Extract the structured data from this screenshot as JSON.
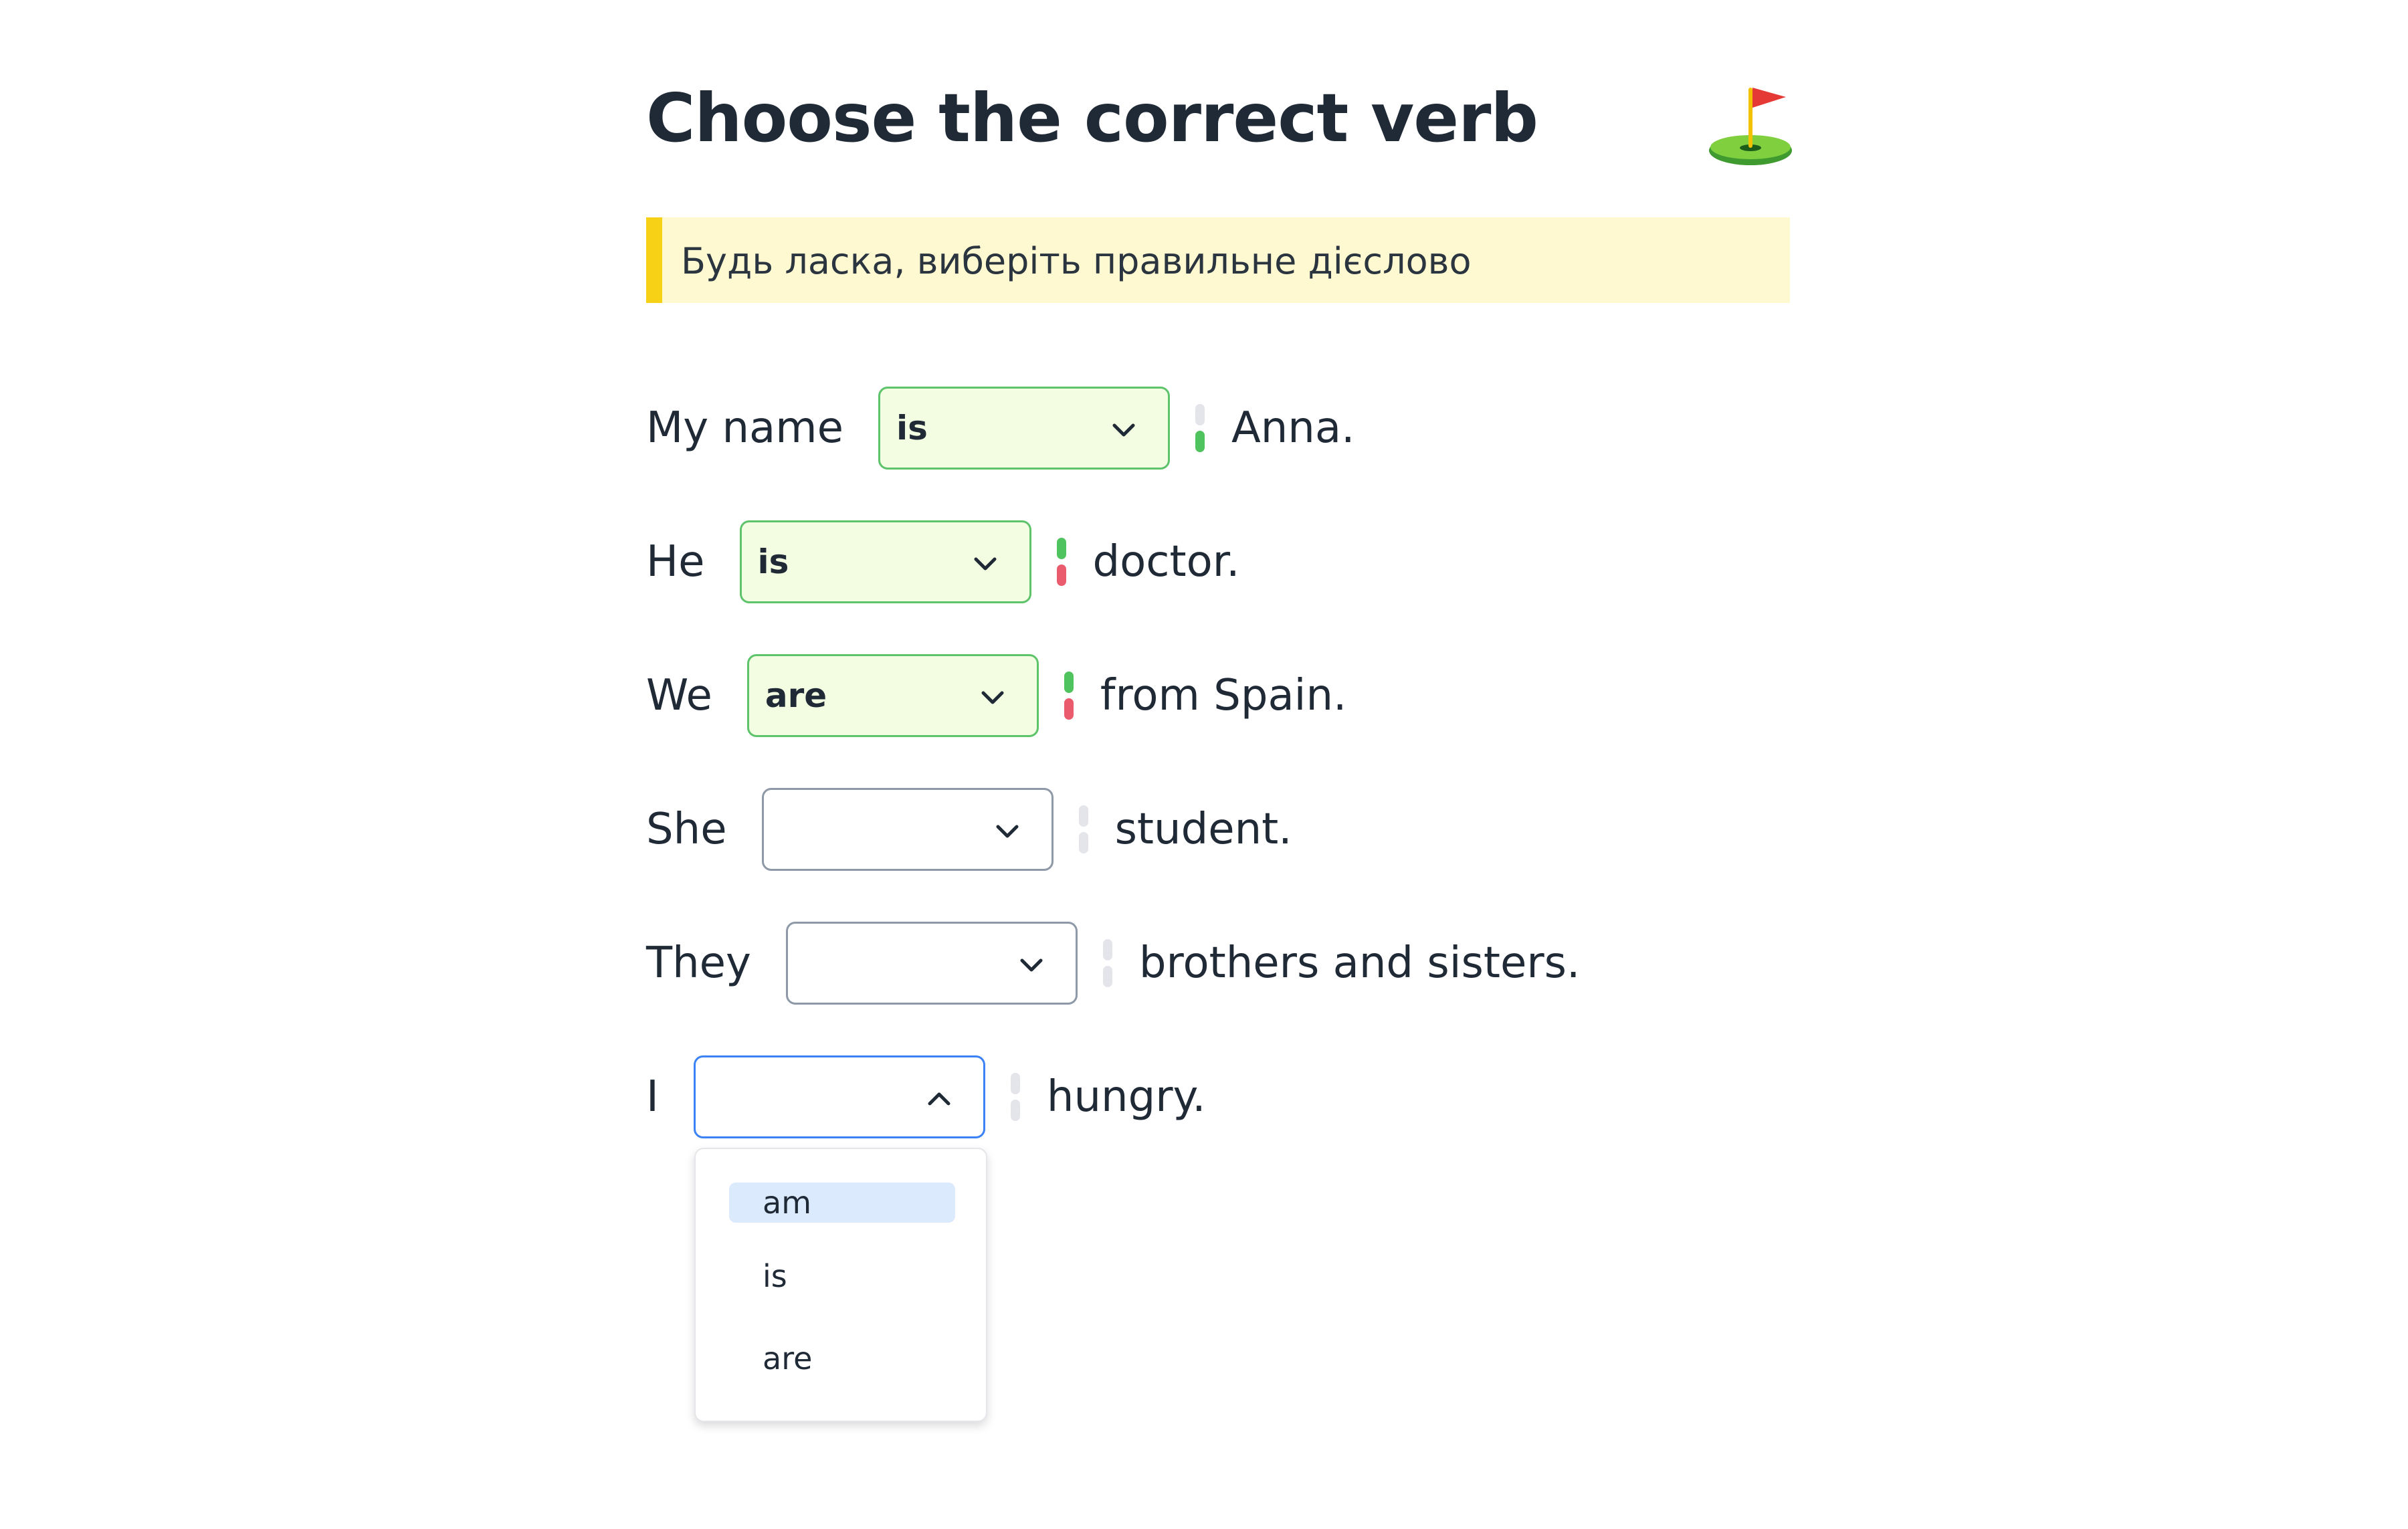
{
  "title": "Choose the correct verb",
  "flag_icon": "golf-flag-icon",
  "instruction": "Будь ласка, виберіть правильне дієслово",
  "colors": {
    "correct_border": "#5ec46b",
    "correct_bg": "#f3fde2",
    "instruction_bg": "#fef9d1",
    "instruction_bar": "#f7d116",
    "open_border": "#3b82f6",
    "indicator_green": "#4ec35e",
    "indicator_red": "#ea5b6e"
  },
  "sentences": [
    {
      "prefix": "My name",
      "selected": "is",
      "suffix": "Anna.",
      "state": "correct",
      "indicator": [
        "gray",
        "green"
      ]
    },
    {
      "prefix": "He",
      "selected": "is",
      "suffix": "doctor.",
      "state": "correct",
      "indicator": [
        "green",
        "red"
      ]
    },
    {
      "prefix": "We",
      "selected": "are",
      "suffix": "from Spain.",
      "state": "correct",
      "indicator": [
        "green",
        "red"
      ]
    },
    {
      "prefix": "She",
      "selected": "",
      "suffix": "student.",
      "state": "empty",
      "indicator": [
        "gray",
        "gray"
      ]
    },
    {
      "prefix": "They",
      "selected": "",
      "suffix": "brothers and sisters.",
      "state": "empty",
      "indicator": [
        "gray",
        "gray"
      ]
    },
    {
      "prefix": "I",
      "selected": "",
      "suffix": "hungry.",
      "state": "open",
      "indicator": [
        "gray",
        "gray"
      ]
    }
  ],
  "dropdown": {
    "options": [
      "am",
      "is",
      "are"
    ],
    "highlighted": "am"
  }
}
